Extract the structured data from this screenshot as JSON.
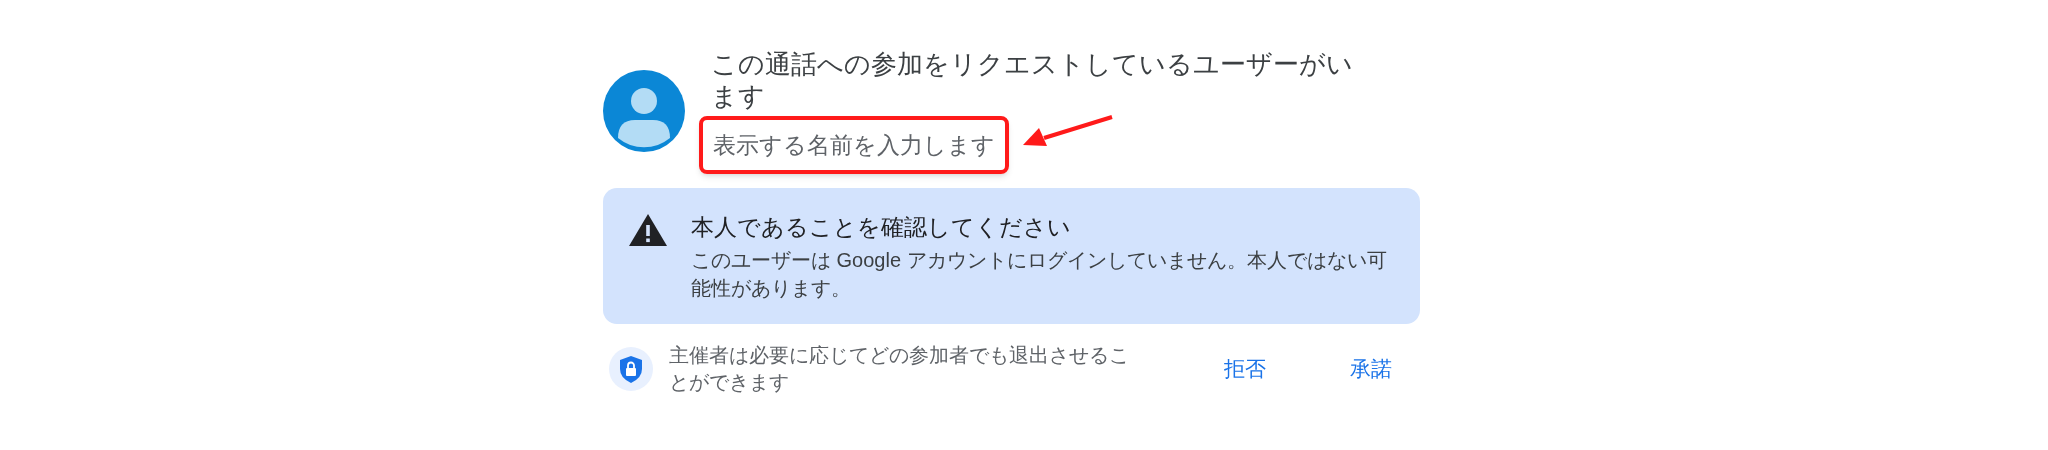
{
  "request": {
    "title": "この通話への参加をリクエストしているユーザーがいます",
    "subtitle": "表示する名前を入力します"
  },
  "warning": {
    "title": "本人であることを確認してください",
    "message": "このユーザーは Google アカウントにログインしていません。本人ではない可能性があります。"
  },
  "footer": {
    "note": "主催者は必要に応じてどの参加者でも退出させることができます",
    "buttons": [
      {
        "label": "拒否"
      },
      {
        "label": "承諾"
      }
    ]
  }
}
